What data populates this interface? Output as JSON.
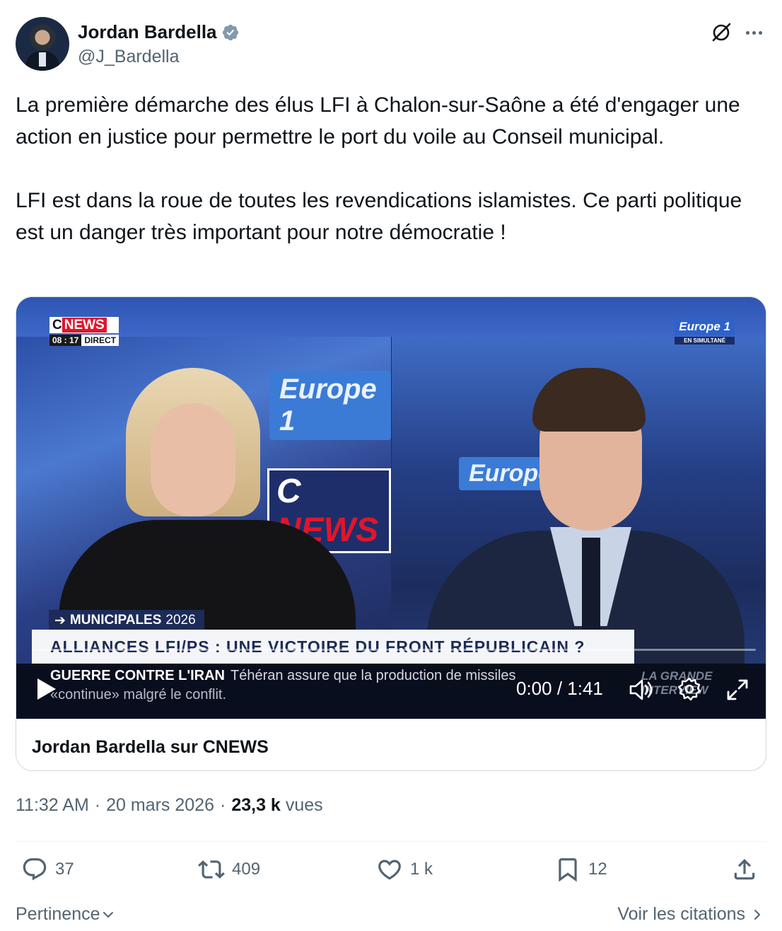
{
  "author": {
    "name": "Jordan Bardella",
    "handle": "@J_Bardella",
    "verified": true
  },
  "tweet": {
    "paragraphs": [
      "La première démarche des élus LFI à Chalon-sur-Saône a été d'engager une action en justice pour permettre le port du voile au Conseil municipal.",
      "LFI est dans la roue de toutes les revendications islamistes. Ce parti politique est un danger très important pour notre démocratie !"
    ]
  },
  "video": {
    "channel_brand_c": "C",
    "channel_brand_news": "NEWS",
    "clock": "08 : 17",
    "live_label": "DIRECT",
    "partner_logo": "Europe 1",
    "partner_sub": "EN SIMULTANÉ",
    "wall_europe": "Europe 1",
    "wall_cnews_c": "C",
    "wall_cnews_news": "NEWS",
    "section_tag": "MUNICIPALES",
    "section_year": "2026",
    "headline": "ALLIANCES LFI/PS : UNE VICTOIRE DU FRONT RÉPUBLICAIN ?",
    "ticker_label": "GUERRE CONTRE L'IRAN",
    "ticker_line1": "Téhéran assure que la production de missiles",
    "ticker_line2": "«continue» malgré le conflit.",
    "show_name_line1": "LA GRANDE",
    "show_name_line2": "INTERVIEW",
    "time_display": "0:00 / 1:41",
    "progress_fraction": 0.0
  },
  "card": {
    "caption": "Jordan Bardella sur CNEWS"
  },
  "meta": {
    "time": "11:32 AM",
    "date": "20 mars 2026",
    "views_count": "23,3 k",
    "views_label": "vues"
  },
  "actions": {
    "replies": "37",
    "reposts": "409",
    "likes": "1 k",
    "bookmarks": "12"
  },
  "footer": {
    "sort_label": "Pertinence",
    "quotes_label": "Voir les citations"
  },
  "colors": {
    "text_primary": "#0f1419",
    "text_secondary": "#536471",
    "verified_blue": "#829aab",
    "border": "#cfd9de",
    "cnews_red": "#e0162b"
  }
}
